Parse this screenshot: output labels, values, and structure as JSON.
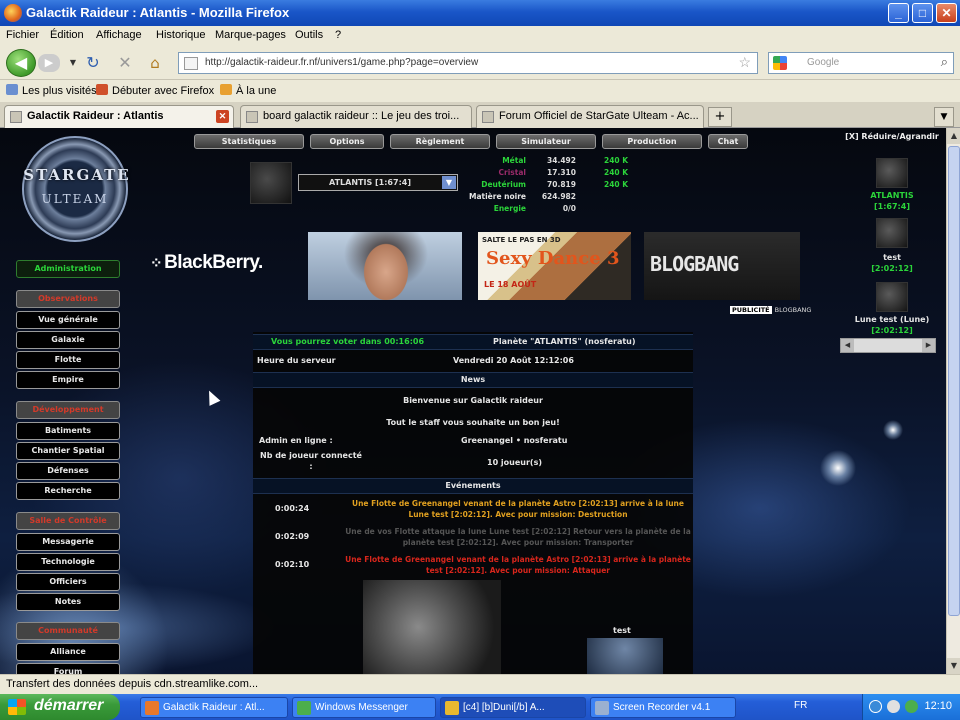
{
  "window": {
    "title": "Galactik Raideur : Atlantis - Mozilla Firefox",
    "minimize": "_",
    "maximize": "□",
    "close": "✕"
  },
  "menu": [
    "Fichier",
    "Édition",
    "Affichage",
    "Historique",
    "Marque-pages",
    "Outils",
    "?"
  ],
  "nav": {
    "url": "http://galactik-raideur.fr.nf/univers1/game.php?page=overview",
    "search_placeholder": "Google"
  },
  "bookmarks": [
    "Les plus visités",
    "Débuter avec Firefox",
    "À la une"
  ],
  "tabs": [
    {
      "label": "Galactik Raideur : Atlantis",
      "active": true
    },
    {
      "label": "board galactik raideur :: Le jeu des troi...",
      "active": false
    },
    {
      "label": "Forum Officiel de StarGate Ulteam - Ac...",
      "active": false
    }
  ],
  "logo": {
    "line1": "STARGATE",
    "line2": "ULTEAM"
  },
  "topnav": [
    "Statistiques",
    "Options",
    "Règlement",
    "Simulateur",
    "Production",
    "Chat"
  ],
  "planet": {
    "selected": "ATLANTIS [1:67:4]"
  },
  "resources": [
    {
      "name": "Métal",
      "value": "34.492",
      "prod": "240 K",
      "color": "#2bd43a"
    },
    {
      "name": "Cristal",
      "value": "17.310",
      "prod": "240 K",
      "color": "#9a2b6a"
    },
    {
      "name": "Deutérium",
      "value": "70.819",
      "prod": "240 K",
      "color": "#2bd43a"
    },
    {
      "name": "Matière noire",
      "value": "624.982",
      "prod": "",
      "color": "#e6e6e6"
    },
    {
      "name": "Energie",
      "value": "0/0",
      "prod": "",
      "color": "#2bd43a"
    }
  ],
  "ads": {
    "blackberry": "BlackBerry.",
    "dance_top": "SALTE LE PAS EN 3D",
    "dance_title": "Sexy Dance 3",
    "dance_date": "LE 18 AOÛT",
    "blog": "BLOGBANG",
    "caption_badge": "PUBLICITÉ",
    "caption": "BLOGBANG"
  },
  "sidebar": [
    {
      "label": "Administration",
      "kind": "green"
    },
    {
      "label": "Observations",
      "kind": "head"
    },
    {
      "label": "Vue générale",
      "kind": "item"
    },
    {
      "label": "Galaxie",
      "kind": "item"
    },
    {
      "label": "Flotte",
      "kind": "item"
    },
    {
      "label": "Empire",
      "kind": "item"
    },
    {
      "label": "Développement",
      "kind": "head"
    },
    {
      "label": "Batiments",
      "kind": "item"
    },
    {
      "label": "Chantier Spatial",
      "kind": "item"
    },
    {
      "label": "Défenses",
      "kind": "item"
    },
    {
      "label": "Recherche",
      "kind": "item"
    },
    {
      "label": "Salle de Contrôle",
      "kind": "head"
    },
    {
      "label": "Messagerie",
      "kind": "item"
    },
    {
      "label": "Technologie",
      "kind": "item"
    },
    {
      "label": "Officiers",
      "kind": "item"
    },
    {
      "label": "Notes",
      "kind": "item"
    },
    {
      "label": "Communauté",
      "kind": "head"
    },
    {
      "label": "Alliance",
      "kind": "item"
    },
    {
      "label": "Forum",
      "kind": "item"
    }
  ],
  "main": {
    "vote": "Vous pourrez voter dans 00:16:06",
    "planet_title": "Planète \"ATLANTIS\" (nosferatu)",
    "server_time_label": "Heure du serveur",
    "server_time": "Vendredi 20 Août 12:12:06",
    "news_header": "News",
    "news_line1": "Bienvenue sur Galactik raideur",
    "news_line2": "Tout le staff vous souhaite un bon jeu!",
    "admin_label": "Admin en ligne :",
    "admin_value": "Greenangel • nosferatu",
    "players_label": "Nb de joueur connecté :",
    "players_value": "10 joueur(s)",
    "events_header": "Evénements",
    "events": [
      {
        "time": "0:00:24",
        "color": "#e0a020",
        "text": "Une Flotte de Greenangel venant de la planète Astro [2:02:13] arrive à la lune Lune test [2:02:12]. Avec pour mission: Destruction"
      },
      {
        "time": "0:02:09",
        "color": "#555555",
        "text": "Une de vos Flotte attaque la lune Lune test [2:02:12] Retour vers la planète de la planète test [2:02:12]. Avec pour mission: Transporter"
      },
      {
        "time": "0:02:10",
        "color": "#d8261c",
        "text": "Une Flotte de Greenangel venant de la planète Astro [2:02:13] arrive à la planète test [2:02:12]. Avec pour mission: Attaquer"
      }
    ],
    "test_label": "test"
  },
  "right": {
    "header": "[X] Réduire/Agrandir",
    "planets": [
      {
        "name": "ATLANTIS",
        "coords": "[1:67:4]"
      },
      {
        "name": "test",
        "coords": "[2:02:12]"
      },
      {
        "name": "Lune test (Lune)",
        "coords": "[2:02:12]"
      }
    ]
  },
  "status": "Transfert des données depuis cdn.streamlike.com...",
  "taskbar": {
    "start": "démarrer",
    "tasks": [
      {
        "label": "Galactik Raideur : Atl...",
        "active": false
      },
      {
        "label": "Windows Messenger",
        "active": false
      },
      {
        "label": "[c4] [b]Duni[/b] A...",
        "active": true
      },
      {
        "label": "Screen Recorder v4.1",
        "active": false
      }
    ],
    "lang": "FR",
    "time": "12:10"
  }
}
